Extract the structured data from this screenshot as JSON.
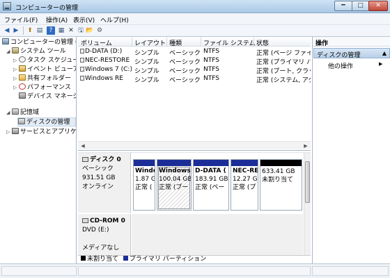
{
  "window": {
    "title": "コンピューターの管理",
    "min_label": "━",
    "max_label": "□",
    "close_label": "✕"
  },
  "menu": [
    "ファイル(F)",
    "操作(A)",
    "表示(V)",
    "ヘルプ(H)"
  ],
  "toolbar": {
    "icons": [
      "back-arrow-icon",
      "forward-arrow-icon",
      "up-icon",
      "show-hide-tree-icon",
      "help-icon",
      "properties-icon",
      "delete-icon",
      "export-icon",
      "open-icon",
      "settings-icon"
    ],
    "glyphs": [
      "◀",
      "▶",
      "⬆",
      "▤",
      "?",
      "▦",
      "✕",
      "🖫",
      "📂",
      "⚙"
    ]
  },
  "tree": [
    {
      "label": "コンピューターの管理 (ロ",
      "arrow": "",
      "icon": "computer-management-icon"
    },
    {
      "label": "システム ツール",
      "arrow": "◢",
      "icon": "system-tools-icon"
    },
    {
      "label": "タスク スケジュー",
      "arrow": "▷",
      "icon": "task-scheduler-icon"
    },
    {
      "label": "イベント ビューア",
      "arrow": "▷",
      "icon": "event-viewer-icon"
    },
    {
      "label": "共有フォルダー",
      "arrow": "▷",
      "icon": "shared-folder-icon"
    },
    {
      "label": "パフォーマンス",
      "arrow": "▷",
      "icon": "performance-icon"
    },
    {
      "label": "デバイス マネージ",
      "arrow": "",
      "icon": "device-manager-icon"
    },
    {
      "label": "記憶域",
      "arrow": "◢",
      "icon": "storage-icon"
    },
    {
      "label": "ディスクの管理",
      "arrow": "",
      "icon": "disk-management-icon"
    },
    {
      "label": "サービスとアプリケー",
      "arrow": "▷",
      "icon": "services-icon"
    }
  ],
  "volume_list": {
    "headers": [
      "ボリューム",
      "レイアウト",
      "種類",
      "ファイル システム",
      "状態"
    ],
    "rows": [
      [
        "D-DATA (D:)",
        "シンプル",
        "ベーシック",
        "NTFS",
        "正常 (ページ ファイ"
      ],
      [
        "NEC-RESTORE",
        "シンプル",
        "ベーシック",
        "NTFS",
        "正常 (プライマリ パ"
      ],
      [
        "Windows 7 (C:)",
        "シンプル",
        "ベーシック",
        "NTFS",
        "正常 (ブート, クラッ"
      ],
      [
        "Windows RE",
        "シンプル",
        "ベーシック",
        "NTFS",
        "正常 (システム, アク"
      ]
    ]
  },
  "disk0": {
    "name": "ディスク 0",
    "type": "ベーシック",
    "size": "931.51 GB",
    "status": "オンライン",
    "partitions": [
      {
        "name": "Windo",
        "size": "1.87 G",
        "status": "正常 ("
      },
      {
        "name": "Windows",
        "size": "100.04 GB",
        "status": "正常 (ブー"
      },
      {
        "name": "D-DATA (",
        "size": "183.91 GB",
        "status": "正常 (ペー"
      },
      {
        "name": "NEC-RE",
        "size": "12.27 G",
        "status": "正常 (プ"
      },
      {
        "name": "",
        "size": "633.41 GB",
        "status": "未割り当て"
      }
    ]
  },
  "cdrom0": {
    "name": "CD-ROM 0",
    "type": "DVD (E:)",
    "status": "メディアなし"
  },
  "legend": {
    "unallocated": "未割り当て",
    "primary": "プライマリ パーティション",
    "unallocated_color": "#000000",
    "primary_color": "#1b2e98"
  },
  "actions": {
    "title": "操作",
    "section": "ディスクの管理",
    "item": "他の操作"
  }
}
